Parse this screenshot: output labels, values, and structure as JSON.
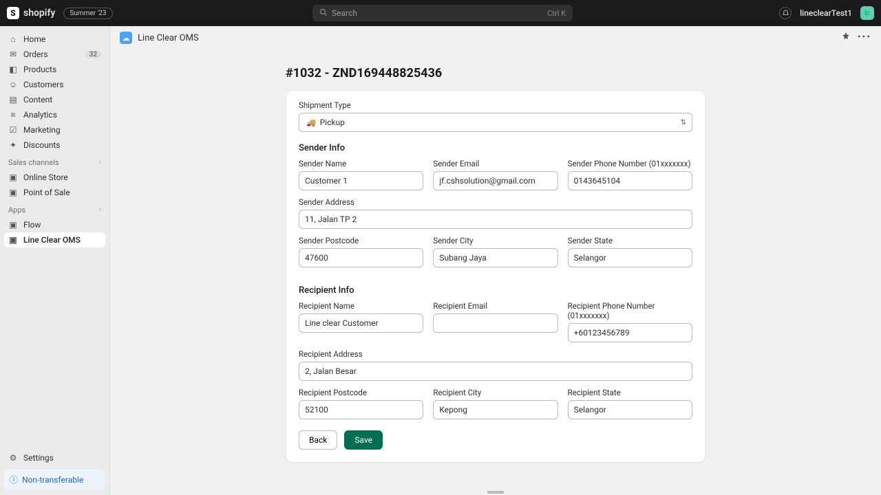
{
  "topbar": {
    "brand": "shopify",
    "season_badge": "Summer '23",
    "search_placeholder": "Search",
    "search_shortcut": "Ctrl K",
    "account_name": "lineclearTest1"
  },
  "sidebar": {
    "main": [
      {
        "icon": "⌂",
        "label": "Home"
      },
      {
        "icon": "✉",
        "label": "Orders",
        "badge": "32"
      },
      {
        "icon": "◧",
        "label": "Products"
      },
      {
        "icon": "☺",
        "label": "Customers"
      },
      {
        "icon": "▤",
        "label": "Content"
      },
      {
        "icon": "≡",
        "label": "Analytics"
      },
      {
        "icon": "☑",
        "label": "Marketing"
      },
      {
        "icon": "✦",
        "label": "Discounts"
      }
    ],
    "channels_title": "Sales channels",
    "channels": [
      {
        "icon": "▣",
        "label": "Online Store"
      },
      {
        "icon": "▣",
        "label": "Point of Sale"
      }
    ],
    "apps_title": "Apps",
    "apps": [
      {
        "icon": "▣",
        "label": "Flow"
      },
      {
        "icon": "▣",
        "label": "Line Clear OMS",
        "active": true
      }
    ],
    "settings_label": "Settings",
    "nontransferable_label": "Non-transferable"
  },
  "page": {
    "app_name": "Line Clear OMS",
    "title": "#1032 - ZND169448825436",
    "shipment_type_label": "Shipment Type",
    "shipment_type_value": "Pickup",
    "sender_title": "Sender Info",
    "recipient_title": "Recipient Info",
    "sender": {
      "name_label": "Sender Name",
      "name": "Customer 1",
      "email_label": "Sender Email",
      "email": "jf.cshsolution@gmail.com",
      "phone_label": "Sender Phone Number (01xxxxxxx)",
      "phone": "0143645104",
      "address_label": "Sender Address",
      "address": "11, Jalan TP 2",
      "postcode_label": "Sender Postcode",
      "postcode": "47600",
      "city_label": "Sender City",
      "city": "Subang Jaya",
      "state_label": "Sender State",
      "state": "Selangor"
    },
    "recipient": {
      "name_label": "Recipient Name",
      "name": "Line clear Customer",
      "email_label": "Recipient Email",
      "email": "",
      "phone_label": "Recipient Phone Number (01xxxxxxx)",
      "phone": "+60123456789",
      "address_label": "Recipient Address",
      "address": "2, Jalan Besar",
      "postcode_label": "Recipient Postcode",
      "postcode": "52100",
      "city_label": "Recipient City",
      "city": "Kepong",
      "state_label": "Recipient State",
      "state": "Selangor"
    },
    "buttons": {
      "back": "Back",
      "save": "Save"
    }
  }
}
